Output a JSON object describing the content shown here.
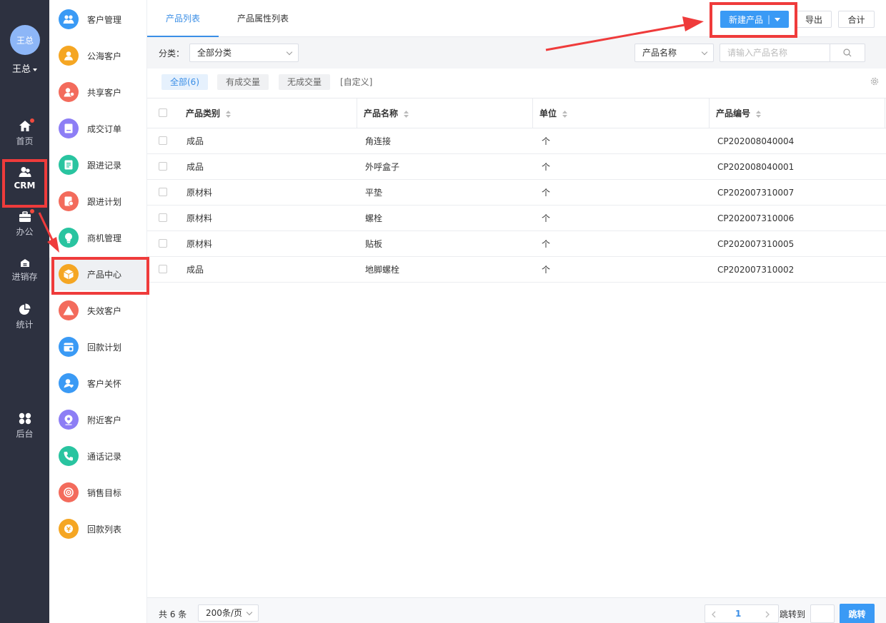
{
  "user": {
    "avatar_text": "王总",
    "name": "王总"
  },
  "nav": [
    {
      "label": "首页",
      "icon": "home-icon",
      "badge": true
    },
    {
      "label": "CRM",
      "icon": "crm-users-icon",
      "badge": false
    },
    {
      "label": "办公",
      "icon": "briefcase-icon",
      "badge": true
    },
    {
      "label": "进销存",
      "icon": "warehouse-icon",
      "badge": false
    },
    {
      "label": "统计",
      "icon": "pie-chart-icon",
      "badge": false
    },
    {
      "label": "后台",
      "icon": "grid-icon",
      "badge": false
    }
  ],
  "menu": [
    {
      "label": "客户管理",
      "icon": "customer-group-icon",
      "color": "#3a9af5"
    },
    {
      "label": "公海客户",
      "icon": "public-customer-icon",
      "color": "#f5a623"
    },
    {
      "label": "共享客户",
      "icon": "shared-customer-icon",
      "color": "#f36b5c"
    },
    {
      "label": "成交订单",
      "icon": "order-icon",
      "color": "#8d7ef5"
    },
    {
      "label": "跟进记录",
      "icon": "followup-record-icon",
      "color": "#29c4a0"
    },
    {
      "label": "跟进计划",
      "icon": "followup-plan-icon",
      "color": "#f36b5c"
    },
    {
      "label": "商机管理",
      "icon": "lightbulb-icon",
      "color": "#29c4a0"
    },
    {
      "label": "产品中心",
      "icon": "product-box-icon",
      "color": "#f5a623"
    },
    {
      "label": "失效客户",
      "icon": "warning-icon",
      "color": "#f36b5c"
    },
    {
      "label": "回款计划",
      "icon": "payment-plan-icon",
      "color": "#3a9af5"
    },
    {
      "label": "客户关怀",
      "icon": "customer-care-icon",
      "color": "#3a9af5"
    },
    {
      "label": "附近客户",
      "icon": "location-icon",
      "color": "#8d7ef5"
    },
    {
      "label": "通话记录",
      "icon": "phone-icon",
      "color": "#29c4a0"
    },
    {
      "label": "销售目标",
      "icon": "target-icon",
      "color": "#f36b5c"
    },
    {
      "label": "回款列表",
      "icon": "payment-list-icon",
      "color": "#f5a623"
    }
  ],
  "tabs": {
    "products": "产品列表",
    "attributes": "产品属性列表"
  },
  "toolbar": {
    "new_product": "新建产品",
    "export": "导出",
    "total": "合计"
  },
  "filters": {
    "category_label": "分类：",
    "category_value": "全部分类",
    "search_field": "产品名称",
    "search_placeholder": "请输入产品名称"
  },
  "chips": [
    "全部(6)",
    "有成交量",
    "无成交量",
    "[自定义]"
  ],
  "table": {
    "headers": [
      "产品类别",
      "产品名称",
      "单位",
      "产品编号"
    ],
    "rows": [
      [
        "成品",
        "角连接",
        "个",
        "CP202008040004"
      ],
      [
        "成品",
        "外呼盒子",
        "个",
        "CP202008040001"
      ],
      [
        "原材料",
        "平垫",
        "个",
        "CP202007310007"
      ],
      [
        "原材料",
        "螺栓",
        "个",
        "CP202007310006"
      ],
      [
        "原材料",
        "贴板",
        "个",
        "CP202007310005"
      ],
      [
        "成品",
        "地脚螺栓",
        "个",
        "CP202007310002"
      ]
    ]
  },
  "footer": {
    "total": "共 6 条",
    "page_size": "200条/页",
    "current_page": "1",
    "jump_label": "跳转到",
    "jump_button": "跳转"
  },
  "colors": {
    "accent": "#3a9af5",
    "annotation": "#ef3b3b",
    "nav_bg": "#2d3140"
  }
}
